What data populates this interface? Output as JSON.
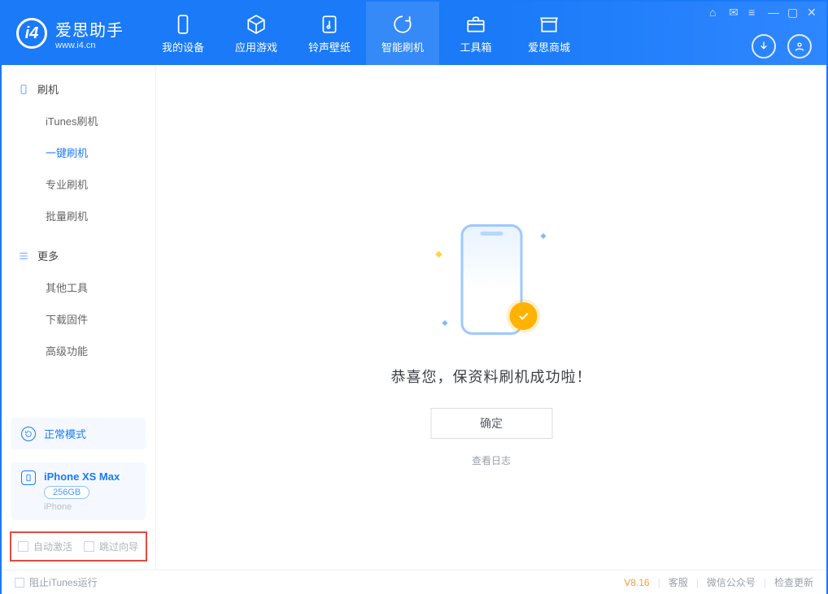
{
  "app": {
    "name": "爱思助手",
    "url": "www.i4.cn"
  },
  "nav": {
    "items": [
      {
        "label": "我的设备"
      },
      {
        "label": "应用游戏"
      },
      {
        "label": "铃声壁纸"
      },
      {
        "label": "智能刷机"
      },
      {
        "label": "工具箱"
      },
      {
        "label": "爱思商城"
      }
    ],
    "active_index": 3
  },
  "sidebar": {
    "group1": {
      "title": "刷机",
      "items": [
        "iTunes刷机",
        "一键刷机",
        "专业刷机",
        "批量刷机"
      ],
      "active_index": 1
    },
    "group2": {
      "title": "更多",
      "items": [
        "其他工具",
        "下载固件",
        "高级功能"
      ]
    }
  },
  "status": {
    "mode": "正常模式"
  },
  "device": {
    "name": "iPhone XS Max",
    "capacity": "256GB",
    "type": "iPhone"
  },
  "options": {
    "auto_activate": {
      "label": "自动激活",
      "checked": false
    },
    "skip_wizard": {
      "label": "跳过向导",
      "checked": false
    }
  },
  "main": {
    "message": "恭喜您，保资料刷机成功啦！",
    "confirm": "确定",
    "view_log": "查看日志"
  },
  "footer": {
    "block_itunes": {
      "label": "阻止iTunes运行",
      "checked": false
    },
    "version": "V8.16",
    "links": [
      "客服",
      "微信公众号",
      "检查更新"
    ]
  }
}
